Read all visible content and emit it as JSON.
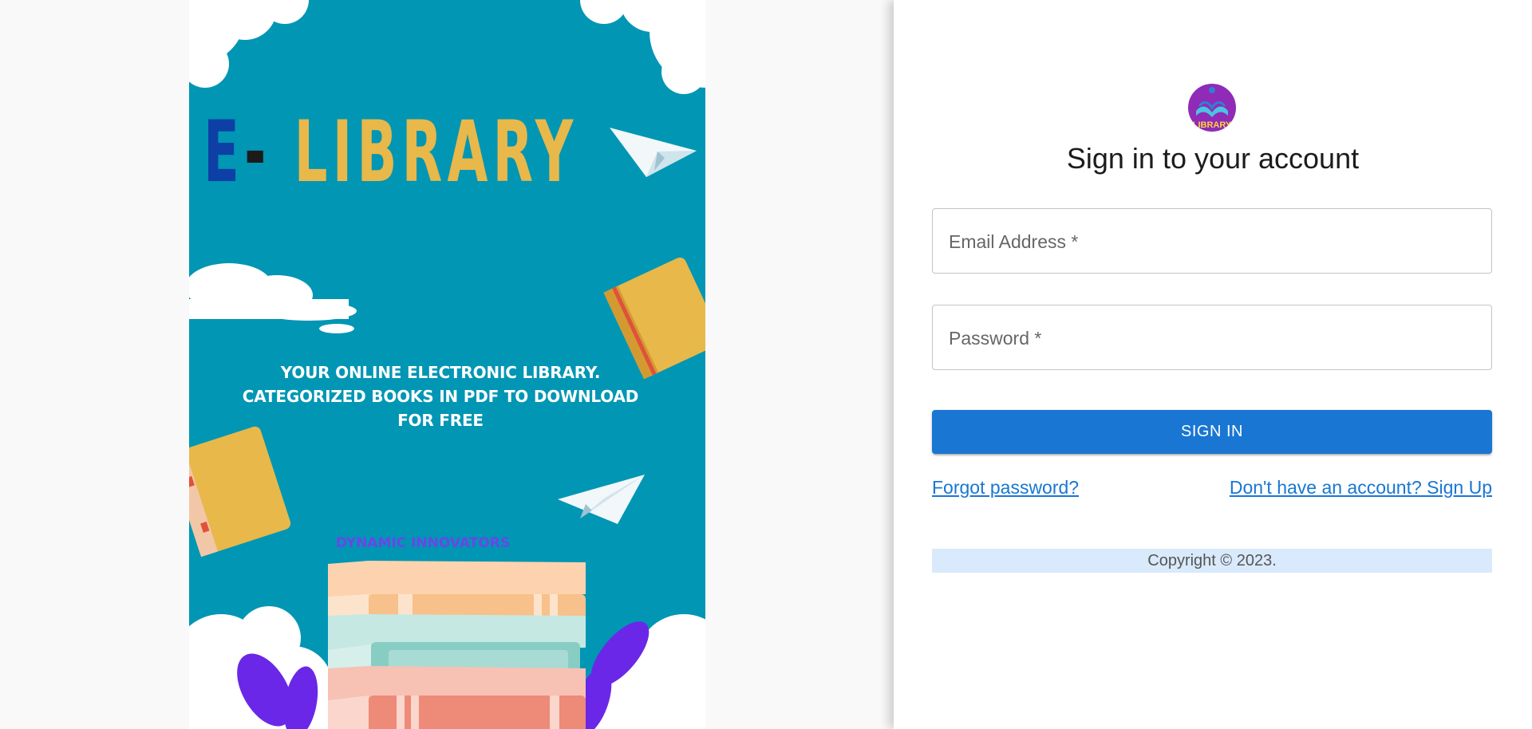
{
  "poster": {
    "title_e": "E",
    "title_dash": "-",
    "title_library": "LIBRARY",
    "tagline": "YOUR ONLINE ELECTRONIC LIBRARY. CATEGORIZED BOOKS IN PDF TO DOWNLOAD FOR FREE",
    "brand": "DYNAMIC INNOVATORS"
  },
  "auth": {
    "logo_text": "LIBRARY",
    "heading": "Sign in to your account",
    "email_label": "Email Address *",
    "password_label": "Password *",
    "submit_label": "SIGN IN",
    "forgot_link": "Forgot password?",
    "signup_link": "Don't have an account? Sign Up",
    "copyright": "Copyright © 2023."
  },
  "colors": {
    "primary": "#1976d2",
    "poster_bg": "#0096b4",
    "title_yellow": "#e8b84a",
    "title_blue": "#0e3fa6",
    "copyright_bg": "#d8eafb"
  }
}
